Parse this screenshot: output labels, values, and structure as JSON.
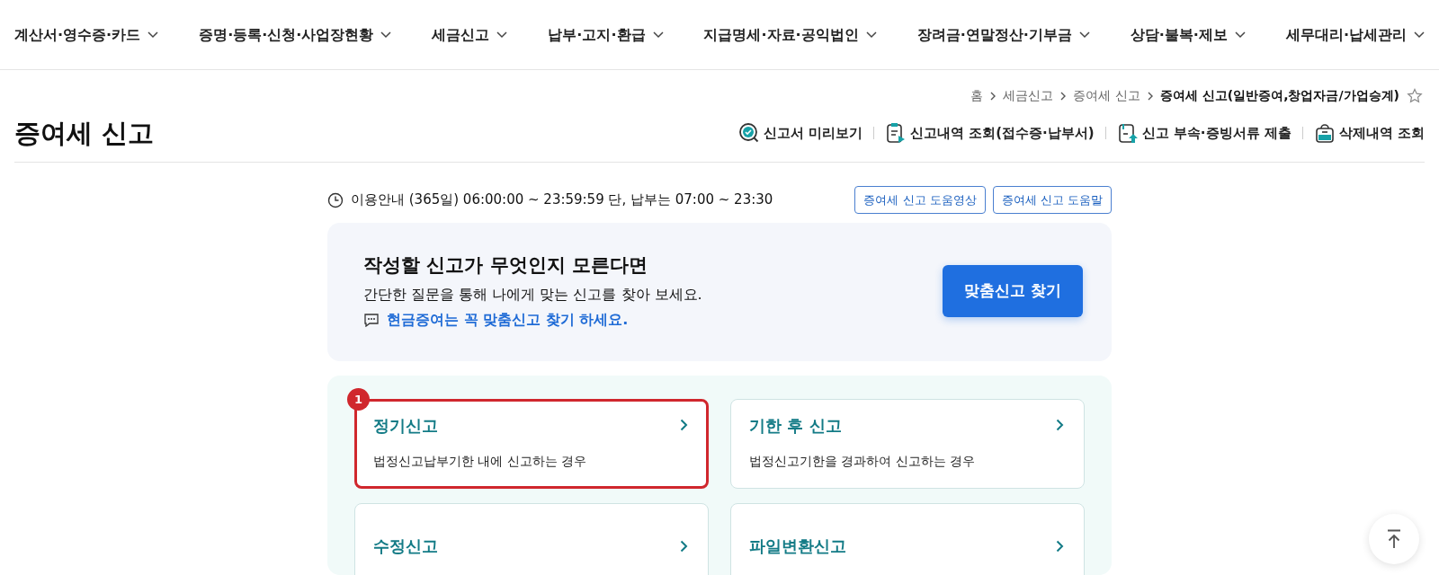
{
  "menu": [
    {
      "label": "계산서·영수증·카드"
    },
    {
      "label": "증명·등록·신청·사업장현황"
    },
    {
      "label": "세금신고"
    },
    {
      "label": "납부·고지·환급"
    },
    {
      "label": "지급명세·자료·공익법인"
    },
    {
      "label": "장려금·연말정산·기부금"
    },
    {
      "label": "상담·불복·제보"
    },
    {
      "label": "세무대리·납세관리"
    }
  ],
  "breadcrumb": [
    {
      "label": "홈",
      "current": false
    },
    {
      "label": "세금신고",
      "current": false
    },
    {
      "label": "증여세 신고",
      "current": false
    },
    {
      "label": "증여세 신고(일반증여,창업자금/가업승계)",
      "current": true
    }
  ],
  "page_title": "증여세 신고",
  "tools": [
    {
      "kind": "preview",
      "label": "신고서 미리보기"
    },
    {
      "kind": "history",
      "label": "신고내역 조회(접수증·납부서)"
    },
    {
      "kind": "upload",
      "label": "신고 부속·증빙서류 제출"
    },
    {
      "kind": "trash",
      "label": "삭제내역 조회"
    }
  ],
  "notice": "이용안내 (365일) 06:00:00 ~ 23:59:59 단, 납부는 07:00 ~ 23:30",
  "help_buttons": [
    "증여세 신고 도움영상",
    "증여세 신고 도움말"
  ],
  "banner": {
    "title": "작성할 신고가 무엇인지 모른다면",
    "text": "간단한 질문을 통해 나에게 맞는 신고를 찾아 보세요.",
    "tip": "현금증여는 꼭 맞춤신고 찾기 하세요.",
    "button": "맞춤신고 찾기"
  },
  "cards": [
    {
      "title": "정기신고",
      "description": "법정신고납부기한 내에 신고하는 경우",
      "highlighted": true,
      "badge": "1"
    },
    {
      "title": "기한 후 신고",
      "description": "법정신고기한을 경과하여 신고하는 경우",
      "highlighted": false
    },
    {
      "title": "수정신고",
      "highlighted": false
    },
    {
      "title": "파일변환신고",
      "highlighted": false
    }
  ]
}
